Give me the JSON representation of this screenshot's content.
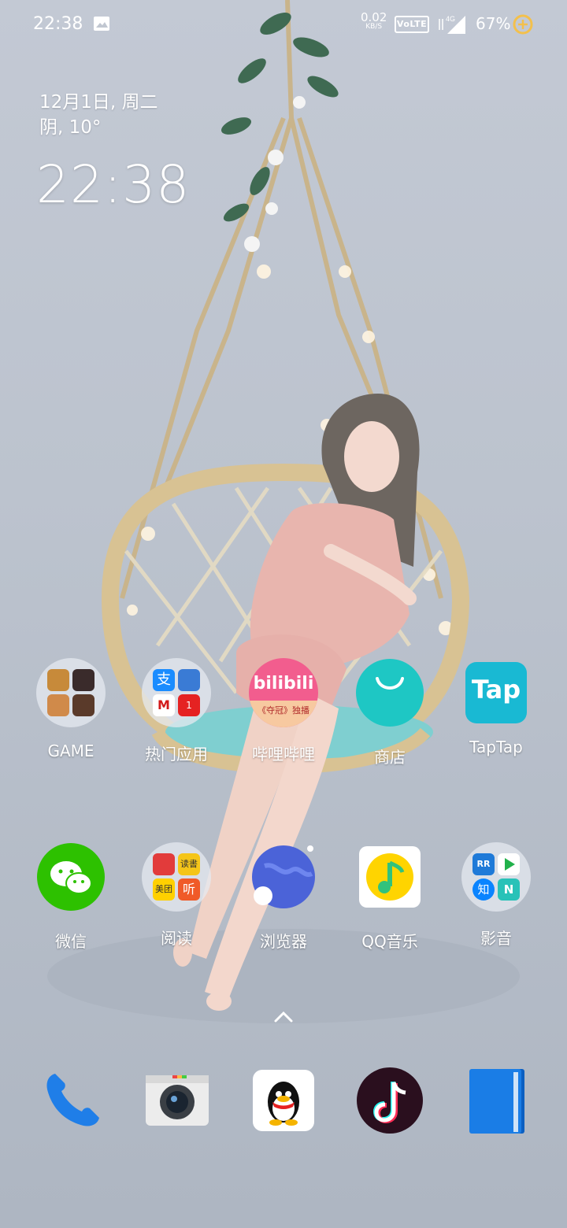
{
  "status_bar": {
    "time": "22:38",
    "net_speed": "0.02",
    "net_unit": "KB/S",
    "volte": "VoLTE",
    "network": "4G",
    "battery": "67%"
  },
  "widget": {
    "date": "12月1日, 周二",
    "weather": "阴, 10°",
    "clock": "22:38"
  },
  "row1": [
    {
      "label": "GAME"
    },
    {
      "label": "热门应用"
    },
    {
      "label": "哔哩哔哩",
      "icon_text_top": "bilibili",
      "icon_text_bottom": "《夺冠》独播"
    },
    {
      "label": "商店"
    },
    {
      "label": "TapTap",
      "icon_text": "Tap"
    }
  ],
  "row2": [
    {
      "label": "微信"
    },
    {
      "label": "阅读",
      "mini": [
        "",
        "读書",
        "美团",
        "听"
      ]
    },
    {
      "label": "浏览器"
    },
    {
      "label": "QQ音乐"
    },
    {
      "label": "影音",
      "mini": [
        "RR",
        "",
        "知",
        "N"
      ]
    }
  ],
  "folder_hot_badge": "1",
  "folder_hot_mini": [
    "支",
    "",
    "M",
    ""
  ],
  "dock": [
    "phone-icon",
    "camera-icon",
    "qq-icon",
    "tiktok-icon",
    "files-icon"
  ],
  "colors": {
    "wechat": "#2dc100",
    "store": "#1ec7c4",
    "taptap": "#19b9d3",
    "bilibili": "#f25d8e",
    "qqmusic": "#ffd400"
  }
}
